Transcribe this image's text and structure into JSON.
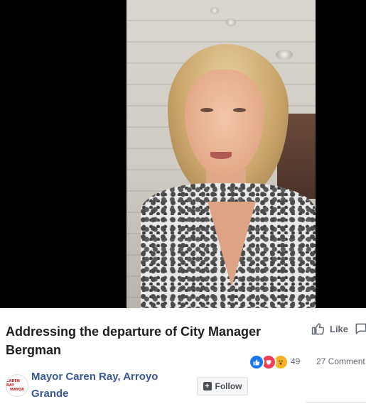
{
  "video": {
    "description_icon": "video-frame"
  },
  "post": {
    "title": "Addressing the departure of City Manager Bergman"
  },
  "actions": {
    "like_label": "Like",
    "like_icon": "thumbs-up-icon",
    "comment_icon": "comment-icon"
  },
  "reactions": {
    "types": [
      "like",
      "love",
      "wow"
    ],
    "count": "49",
    "comments": "27 Comment"
  },
  "page": {
    "avatar_line1": "CAREN RAY",
    "avatar_line2": "MAYOR",
    "name": "Mayor Caren Ray, Arroyo Grande",
    "follow_label": "Follow"
  },
  "colors": {
    "link": "#385898",
    "like_blue": "#1877f2",
    "love_red": "#f33e58",
    "wow_yellow": "#f7b125",
    "muted": "#606770"
  }
}
